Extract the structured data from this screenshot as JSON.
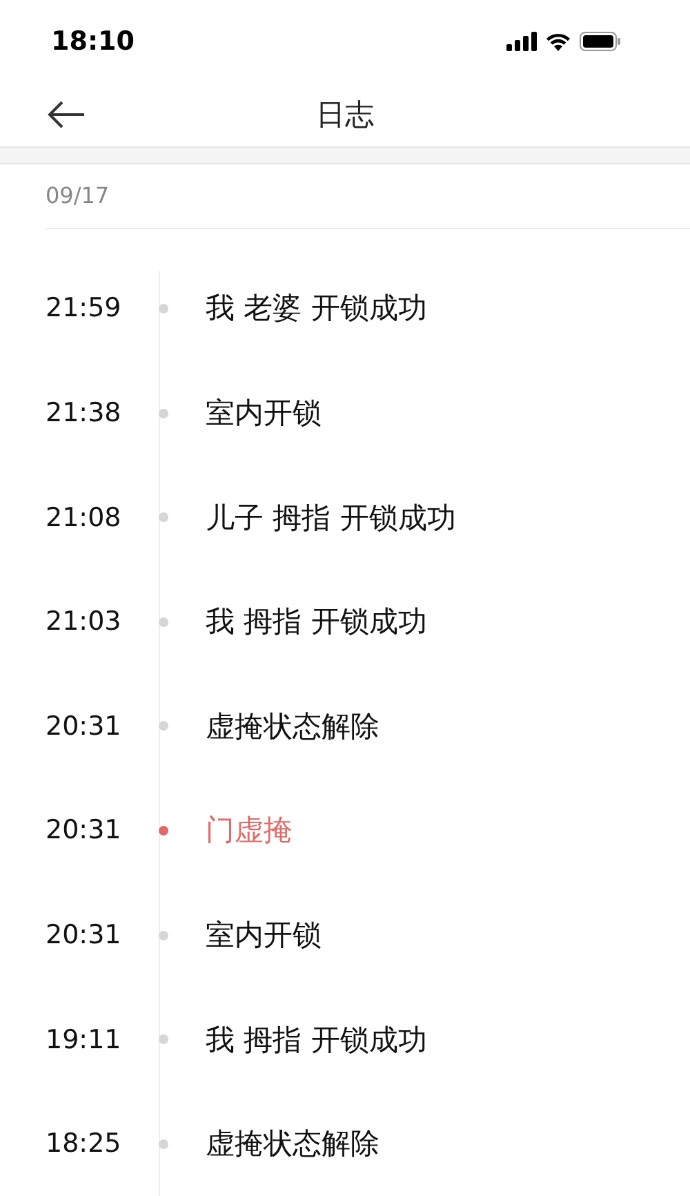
{
  "status_bar": {
    "time": "18:10"
  },
  "nav": {
    "title": "日志"
  },
  "date": "09/17",
  "entries": [
    {
      "time": "21:59",
      "text": "我 老婆 开锁成功",
      "alert": false
    },
    {
      "time": "21:38",
      "text": "室内开锁",
      "alert": false
    },
    {
      "time": "21:08",
      "text": "儿子 拇指 开锁成功",
      "alert": false
    },
    {
      "time": "21:03",
      "text": "我 拇指 开锁成功",
      "alert": false
    },
    {
      "time": "20:31",
      "text": "虚掩状态解除",
      "alert": false
    },
    {
      "time": "20:31",
      "text": "门虚掩",
      "alert": true
    },
    {
      "time": "20:31",
      "text": "室内开锁",
      "alert": false
    },
    {
      "time": "19:11",
      "text": "我 拇指 开锁成功",
      "alert": false
    },
    {
      "time": "18:25",
      "text": "虚掩状态解除",
      "alert": false
    }
  ]
}
